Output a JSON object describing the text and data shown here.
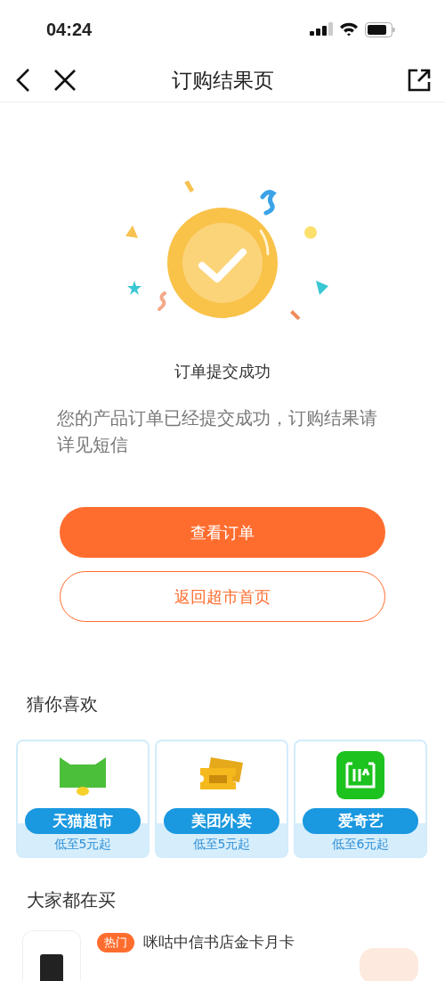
{
  "status_bar": {
    "time": "04:24"
  },
  "nav": {
    "title": "订购结果页"
  },
  "result": {
    "title": "订单提交成功",
    "message": "您的产品订单已经提交成功，订购结果请详见短信"
  },
  "buttons": [
    {
      "label": "查看订单",
      "kind": "primary"
    },
    {
      "label": "返回超市首页",
      "kind": "outline"
    }
  ],
  "recommend": {
    "title": "猜你喜欢",
    "items": [
      {
        "name": "天猫超市",
        "price": "低至5元起",
        "kind": "cat"
      },
      {
        "name": "美团外卖",
        "price": "低至5元起",
        "kind": "ticket"
      },
      {
        "name": "爱奇艺",
        "price": "低至6元起",
        "kind": "tv"
      }
    ]
  },
  "popular": {
    "title": "大家都在买",
    "items": [
      {
        "badge": "热门",
        "name": "咪咕中信书店金卡月卡"
      }
    ]
  }
}
